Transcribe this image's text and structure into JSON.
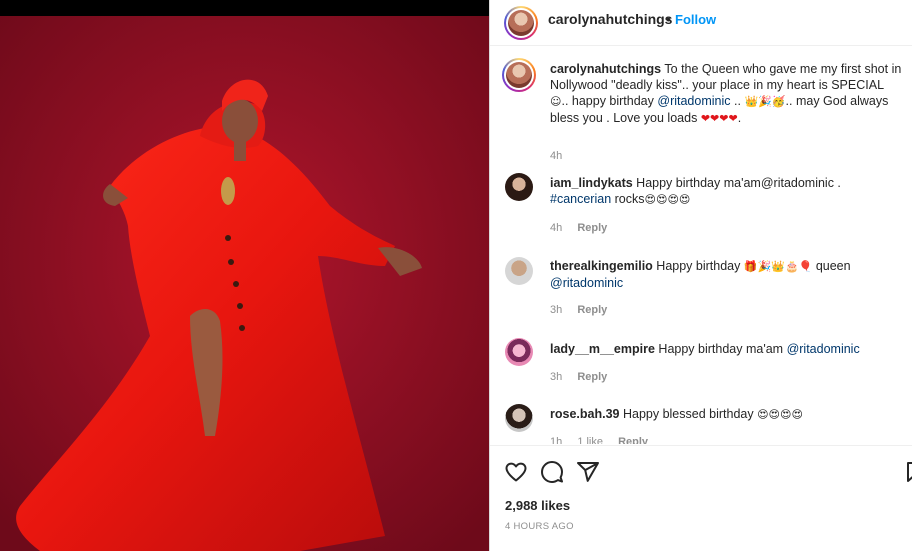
{
  "post": {
    "username": "carolynahutchings",
    "dot": "•",
    "follow_label": "Follow",
    "caption_prefix": "To the Queen who gave me my first shot in Nollywood \"deadly kiss\".. your place in my heart is SPECIAL",
    "caption_mid1": ".. happy birthday",
    "caption_tag": "@ritadominic",
    "caption_mid2": "..",
    "caption_mid3": ".. may God always bless you . Love you loads",
    "caption_end": ".",
    "caption_time": "4h",
    "emojis_a": "☺",
    "emojis_b": "👑🎉🥳",
    "emojis_c": "❤❤❤❤"
  },
  "comments": [
    {
      "user": "iam_lindykats",
      "text": "Happy birthday ma'am@ritadominic .",
      "hashtag": "#cancerian",
      "after": "rocks",
      "emojis": "😍😍😍😍",
      "time": "4h",
      "reply": "Reply"
    },
    {
      "user": "therealkingemilio",
      "text": "Happy birthday",
      "emojis": "🎁🎉👑🎂🎈",
      "after": "queen",
      "tag": "@ritadominic",
      "time": "3h",
      "reply": "Reply"
    },
    {
      "user": "lady__m__empire",
      "text": "Happy birthday ma'am",
      "tag": "@ritadominic",
      "time": "3h",
      "reply": "Reply"
    },
    {
      "user": "rose.bah.39",
      "text": "Happy blessed birthday",
      "emojis": "😍😍😍😍",
      "time": "1h",
      "likes": "1 like",
      "reply": "Reply"
    }
  ],
  "footer": {
    "likes": "2,988 likes",
    "time": "4 HOURS AGO"
  },
  "colors": {
    "accent": "#0095f6",
    "tag": "#00376b",
    "meta": "#8e8e8e"
  }
}
